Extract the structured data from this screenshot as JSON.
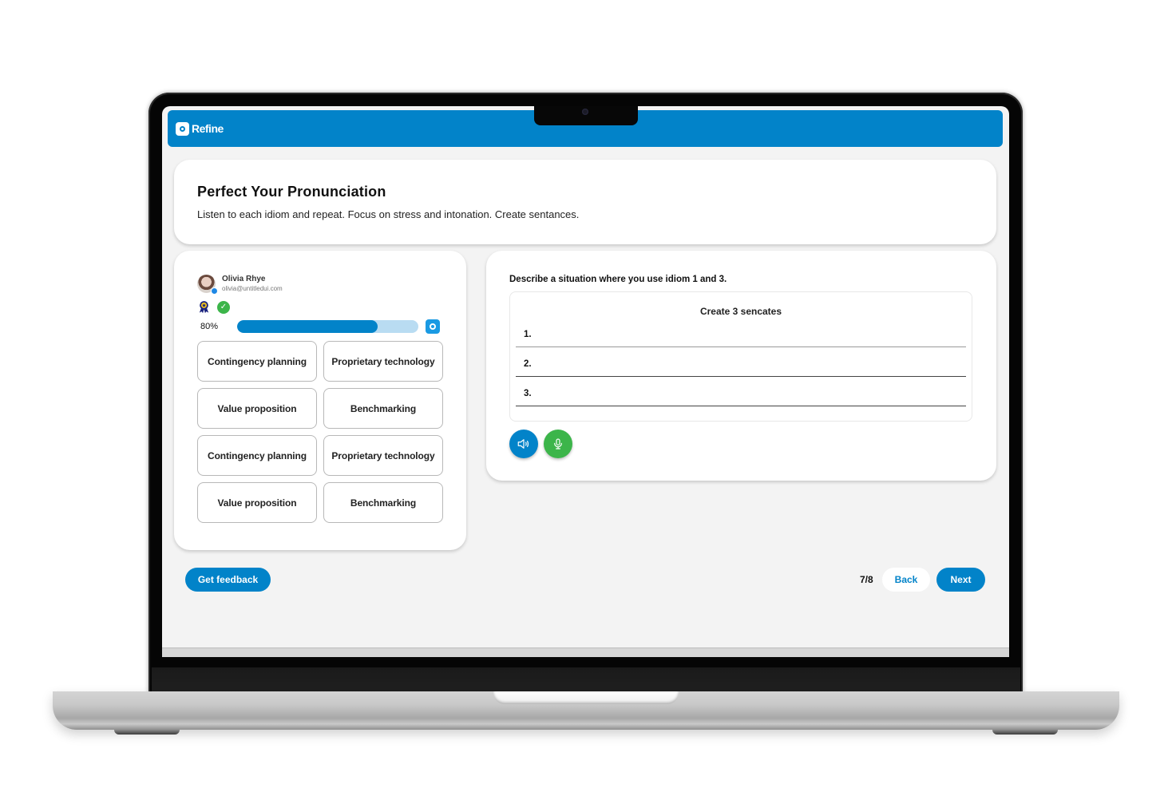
{
  "app": {
    "brand": "Refine"
  },
  "header": {
    "title": "Perfect Your Pronunciation",
    "subtitle": "Listen to each idiom and repeat. Focus on stress and intonation. Create sentances."
  },
  "user": {
    "name": "Olivia Rhye",
    "email": "olivia@untitledui.com",
    "badges": [
      "award-icon",
      "check-icon"
    ]
  },
  "progress": {
    "label": "80%",
    "value": 0.8
  },
  "idioms": [
    {
      "label": "Contingency planning"
    },
    {
      "label": "Proprietary technology"
    },
    {
      "label": "Value proposition"
    },
    {
      "label": "Benchmarking"
    },
    {
      "label": "Contingency planning"
    },
    {
      "label": "Proprietary technology"
    },
    {
      "label": "Value proposition"
    },
    {
      "label": "Benchmarking"
    }
  ],
  "exercise": {
    "prompt": "Describe a situation where you use idiom 1 and 3.",
    "box_title": "Create 3 sencates",
    "lines": [
      "1.",
      "2.",
      "3."
    ],
    "buttons": {
      "listen": "speaker-icon",
      "record": "microphone-icon"
    }
  },
  "footer": {
    "feedback_label": "Get feedback",
    "page_indicator": "7/8",
    "back_label": "Back",
    "next_label": "Next"
  },
  "colors": {
    "primary": "#0283c9",
    "success": "#3cb54a",
    "progress_track": "#b9dcf2",
    "background": "#f3f3f3"
  }
}
